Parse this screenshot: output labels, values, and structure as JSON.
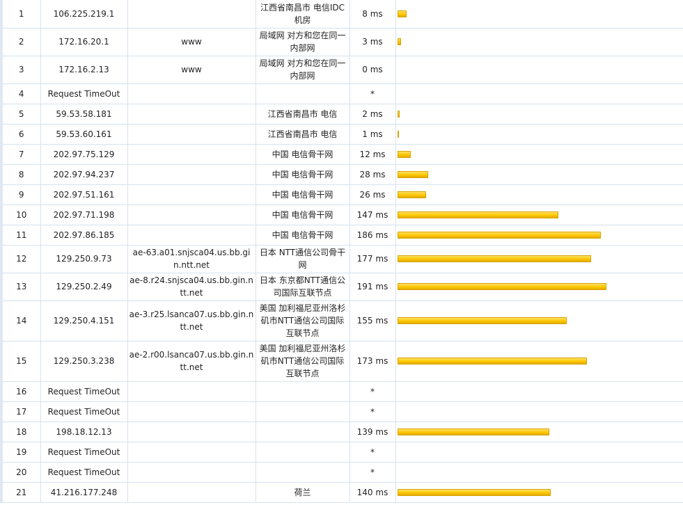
{
  "rows": [
    {
      "hop": "1",
      "ip": "106.225.219.1",
      "host": "",
      "loc": "江西省南昌市 电信IDC机房",
      "time": "8 ms",
      "ms": 8
    },
    {
      "hop": "2",
      "ip": "172.16.20.1",
      "host": "www",
      "loc": "局域网 对方和您在同一内部网",
      "time": "3 ms",
      "ms": 3
    },
    {
      "hop": "3",
      "ip": "172.16.2.13",
      "host": "www",
      "loc": "局域网 对方和您在同一内部网",
      "time": "0 ms",
      "ms": 0
    },
    {
      "hop": "4",
      "ip": "Request TimeOut",
      "host": "",
      "loc": "",
      "time": "*",
      "ms": null
    },
    {
      "hop": "5",
      "ip": "59.53.58.181",
      "host": "",
      "loc": "江西省南昌市 电信",
      "time": "2 ms",
      "ms": 2
    },
    {
      "hop": "6",
      "ip": "59.53.60.161",
      "host": "",
      "loc": "江西省南昌市 电信",
      "time": "1 ms",
      "ms": 1
    },
    {
      "hop": "7",
      "ip": "202.97.75.129",
      "host": "",
      "loc": "中国 电信骨干网",
      "time": "12 ms",
      "ms": 12
    },
    {
      "hop": "8",
      "ip": "202.97.94.237",
      "host": "",
      "loc": "中国 电信骨干网",
      "time": "28 ms",
      "ms": 28
    },
    {
      "hop": "9",
      "ip": "202.97.51.161",
      "host": "",
      "loc": "中国 电信骨干网",
      "time": "26 ms",
      "ms": 26
    },
    {
      "hop": "10",
      "ip": "202.97.71.198",
      "host": "",
      "loc": "中国 电信骨干网",
      "time": "147 ms",
      "ms": 147
    },
    {
      "hop": "11",
      "ip": "202.97.86.185",
      "host": "",
      "loc": "中国 电信骨干网",
      "time": "186 ms",
      "ms": 186
    },
    {
      "hop": "12",
      "ip": "129.250.9.73",
      "host": "ae-63.a01.snjsca04.us.bb.gin.ntt.net",
      "loc": "日本 NTT通信公司骨干网",
      "time": "177 ms",
      "ms": 177
    },
    {
      "hop": "13",
      "ip": "129.250.2.49",
      "host": "ae-8.r24.snjsca04.us.bb.gin.ntt.net",
      "loc": "日本 东京都NTT通信公司国际互联节点",
      "time": "191 ms",
      "ms": 191
    },
    {
      "hop": "14",
      "ip": "129.250.4.151",
      "host": "ae-3.r25.lsanca07.us.bb.gin.ntt.net",
      "loc": "美国 加利福尼亚州洛杉矶市NTT通信公司国际互联节点",
      "time": "155 ms",
      "ms": 155
    },
    {
      "hop": "15",
      "ip": "129.250.3.238",
      "host": "ae-2.r00.lsanca07.us.bb.gin.ntt.net",
      "loc": "美国 加利福尼亚州洛杉矶市NTT通信公司国际互联节点",
      "time": "173 ms",
      "ms": 173
    },
    {
      "hop": "16",
      "ip": "Request TimeOut",
      "host": "",
      "loc": "",
      "time": "*",
      "ms": null
    },
    {
      "hop": "17",
      "ip": "Request TimeOut",
      "host": "",
      "loc": "",
      "time": "*",
      "ms": null
    },
    {
      "hop": "18",
      "ip": "198.18.12.13",
      "host": "",
      "loc": "",
      "time": "139 ms",
      "ms": 139
    },
    {
      "hop": "19",
      "ip": "Request TimeOut",
      "host": "",
      "loc": "",
      "time": "*",
      "ms": null
    },
    {
      "hop": "20",
      "ip": "Request TimeOut",
      "host": "",
      "loc": "",
      "time": "*",
      "ms": null
    },
    {
      "hop": "21",
      "ip": "41.216.177.248",
      "host": "",
      "loc": "荷兰",
      "time": "140 ms",
      "ms": 140
    }
  ],
  "bar_color": "#ffc700"
}
